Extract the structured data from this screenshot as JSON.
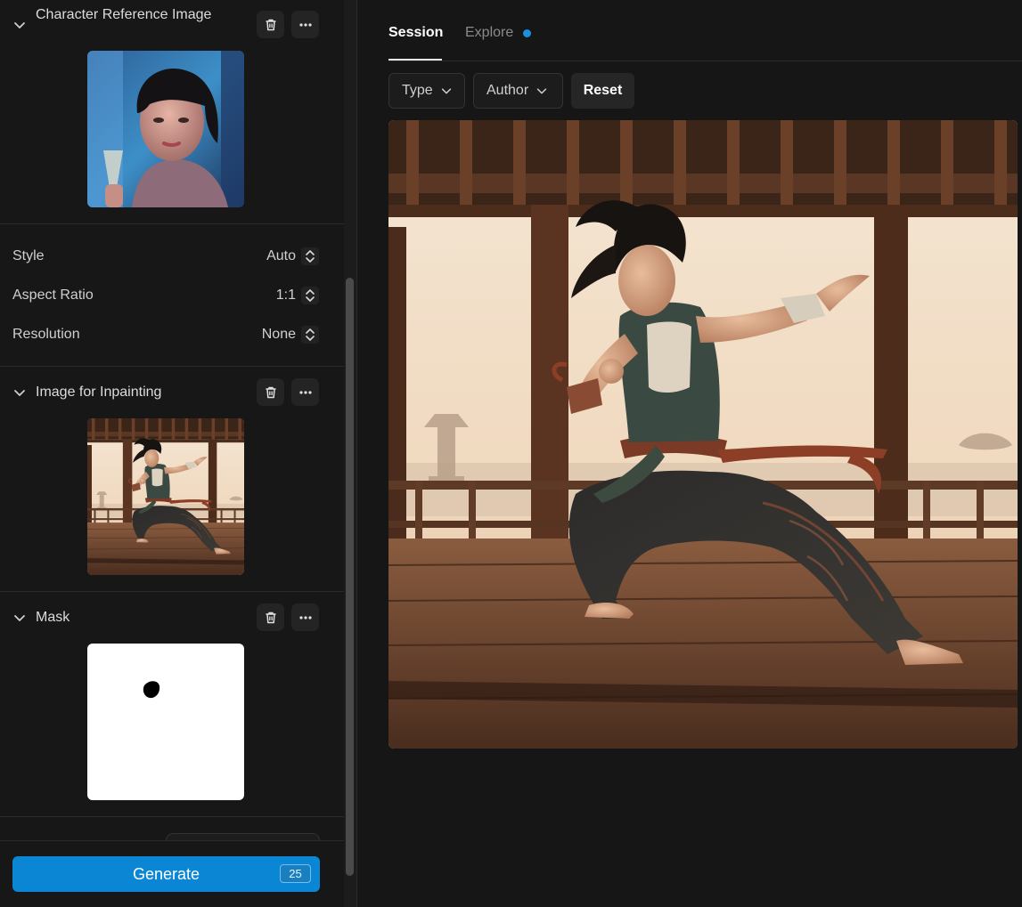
{
  "left_panel": {
    "character_reference": {
      "title": "Character Reference Image"
    },
    "settings": [
      {
        "label": "Style",
        "value": "Auto"
      },
      {
        "label": "Aspect Ratio",
        "value": "1:1"
      },
      {
        "label": "Resolution",
        "value": "None"
      }
    ],
    "inpainting": {
      "title": "Image for Inpainting"
    },
    "mask": {
      "title": "Mask"
    },
    "generate": {
      "label": "Generate",
      "count": "25"
    }
  },
  "tabs": [
    {
      "label": "Session",
      "active": true
    },
    {
      "label": "Explore",
      "active": false,
      "has_dot": true
    }
  ],
  "filters": {
    "type_label": "Type",
    "author_label": "Author",
    "reset_label": "Reset"
  },
  "colors": {
    "accent": "#0b86d4",
    "dot": "#1b8fe0",
    "background": "#161616"
  },
  "icons": {
    "collapse": "chevron-down-icon",
    "delete": "trash-icon",
    "more": "more-horizontal-icon",
    "stepper": "up-down-icon"
  }
}
